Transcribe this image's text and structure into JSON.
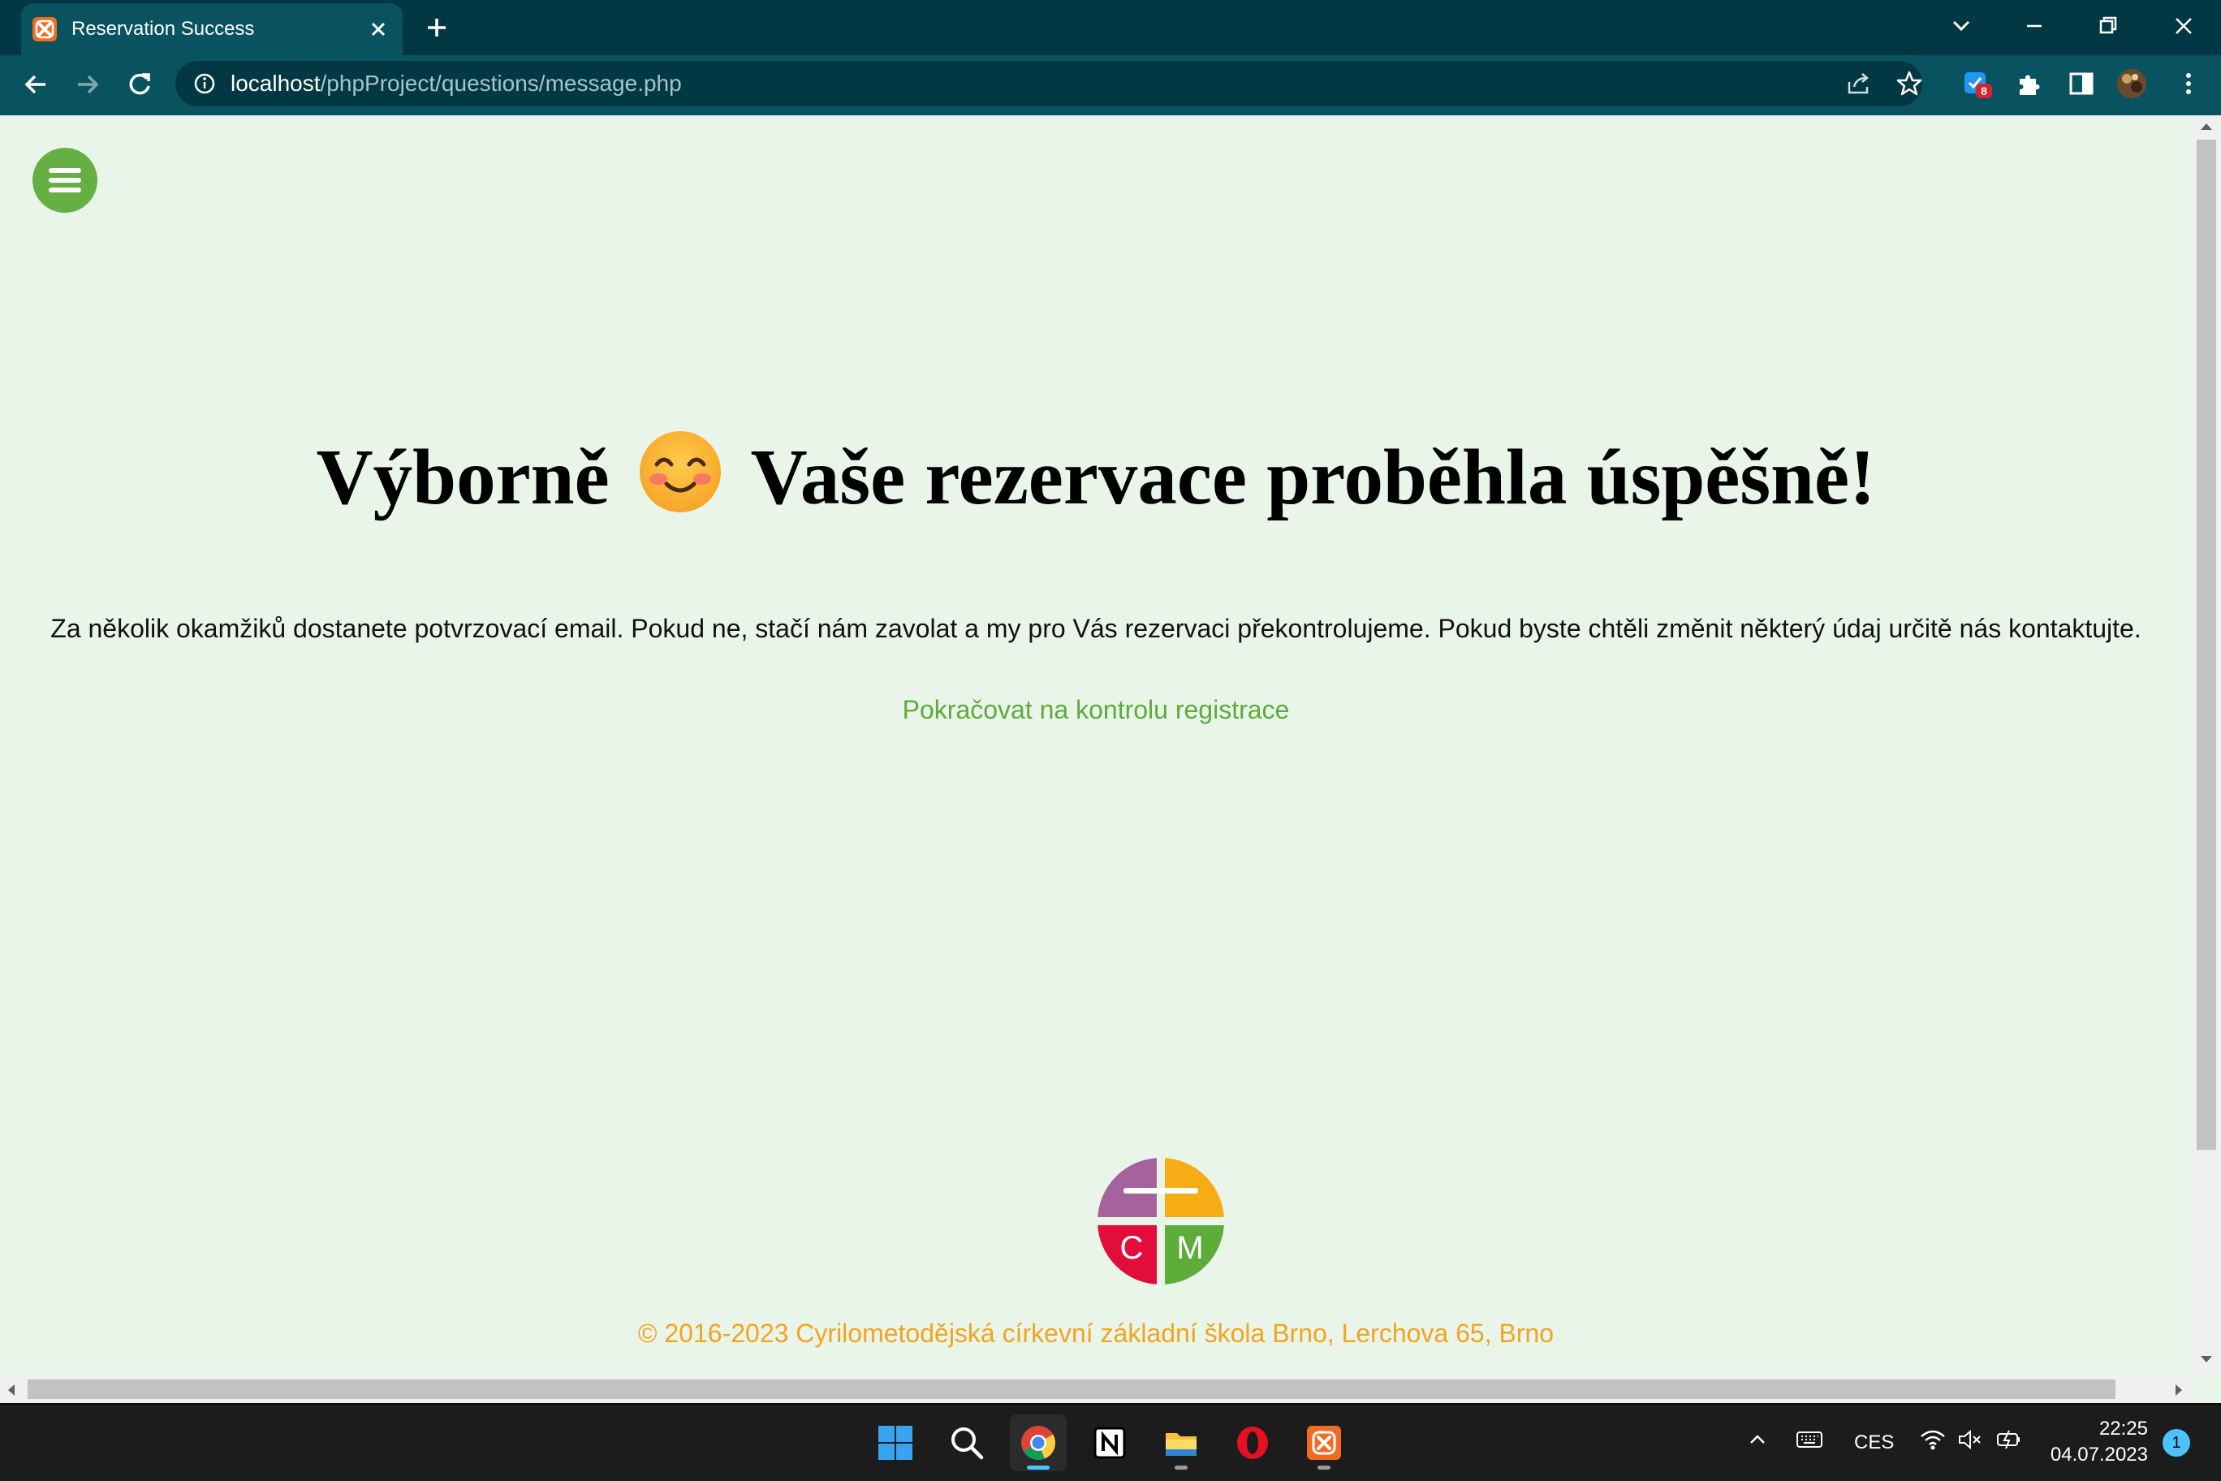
{
  "browser": {
    "tab_title": "Reservation Success",
    "url_host": "localhost",
    "url_path": "/phpProject/questions/message.php",
    "extension_badge": "8"
  },
  "page": {
    "headline_before": "Výborně",
    "headline_emoji": "smiling-face-with-smiling-eyes",
    "headline_after": "Vaše rezervace proběhla úspěšně!",
    "message": "Za několik okamžiků dostanete potvrzovací email. Pokud ne, stačí nám zavolat a my pro Vás rezervaci překontrolujeme. Pokud byste chtěli změnit některý údaj určitě nás kontaktujte.",
    "continue_link": "Pokračovat na kontrolu registrace",
    "logo_letters": [
      "C",
      "M"
    ],
    "footer": "© 2016-2023 Cyrilometodějská církevní základní škola Brno, Lerchova 65, Brno"
  },
  "taskbar": {
    "language": "CES",
    "time": "22:25",
    "date": "04.07.2023",
    "notifications": "1"
  },
  "colors": {
    "chrome_dark": "#023844",
    "chrome_toolbar": "#08535f",
    "page_bg": "#e9f5e9",
    "menu_green": "#66b043",
    "link_green": "#5cab3c",
    "footer_orange": "#f2a41f"
  }
}
